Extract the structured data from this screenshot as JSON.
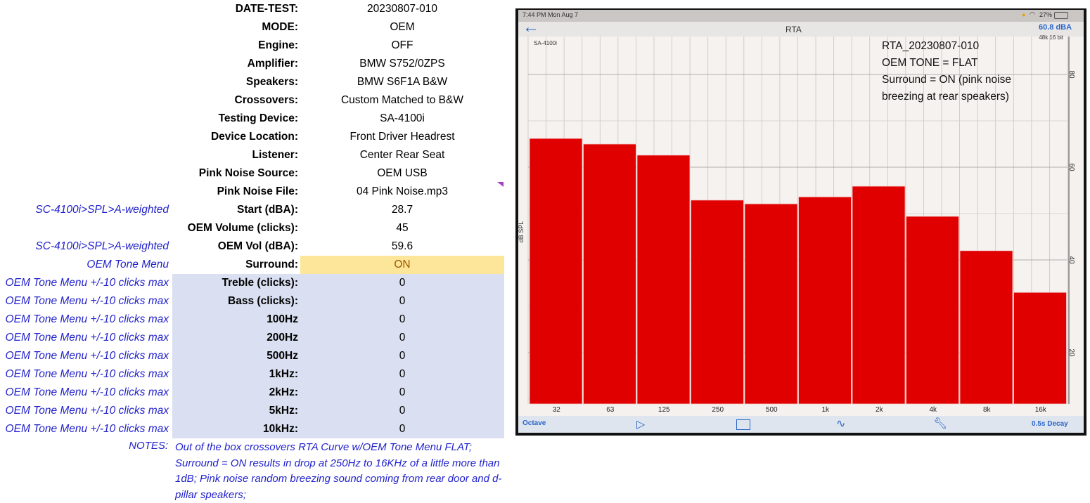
{
  "sheet": {
    "rows": [
      {
        "note": "",
        "label": "DATE-TEST:",
        "value": "20230807-010"
      },
      {
        "note": "",
        "label": "MODE:",
        "value": "OEM"
      },
      {
        "note": "",
        "label": "Engine:",
        "value": "OFF"
      },
      {
        "note": "",
        "label": "Amplifier:",
        "value": "BMW S752/0ZPS"
      },
      {
        "note": "",
        "label": "Speakers:",
        "value": "BMW S6F1A B&W"
      },
      {
        "note": "",
        "label": "Crossovers:",
        "value": "Custom Matched to B&W"
      },
      {
        "note": "",
        "label": "Testing Device:",
        "value": "SA-4100i"
      },
      {
        "note": "",
        "label": "Device Location:",
        "value": "Front Driver Headrest"
      },
      {
        "note": "",
        "label": "Listener:",
        "value": "Center Rear Seat"
      },
      {
        "note": "",
        "label": "Pink Noise Source:",
        "value": "OEM USB"
      },
      {
        "note": "",
        "label": "Pink Noise File:",
        "value": "04 Pink Noise.mp3"
      },
      {
        "note": "SC-4100i>SPL>A-weighted",
        "label": "Start (dBA):",
        "value": "28.7"
      },
      {
        "note": "",
        "label": "OEM Volume (clicks):",
        "value": "45"
      },
      {
        "note": "SC-4100i>SPL>A-weighted",
        "label": "OEM Vol (dBA):",
        "value": "59.6"
      },
      {
        "note": "OEM Tone Menu",
        "label": "Surround:",
        "value": "ON"
      },
      {
        "note": "OEM Tone Menu +/-10 clicks max",
        "label": "Treble (clicks):",
        "value": "0"
      },
      {
        "note": "OEM Tone Menu +/-10 clicks max",
        "label": "Bass (clicks):",
        "value": "0"
      },
      {
        "note": "OEM Tone Menu +/-10 clicks max",
        "label": "100Hz",
        "value": "0"
      },
      {
        "note": "OEM Tone Menu +/-10 clicks max",
        "label": "200Hz",
        "value": "0"
      },
      {
        "note": "OEM Tone Menu +/-10 clicks max",
        "label": "500Hz",
        "value": "0"
      },
      {
        "note": "OEM Tone Menu +/-10 clicks max",
        "label": "1kHz:",
        "value": "0"
      },
      {
        "note": "OEM Tone Menu +/-10 clicks max",
        "label": "2kHz:",
        "value": "0"
      },
      {
        "note": "OEM Tone Menu +/-10 clicks max",
        "label": "5kHz:",
        "value": "0"
      },
      {
        "note": "OEM Tone Menu +/-10 clicks max",
        "label": "10kHz:",
        "value": "0"
      }
    ],
    "notes_label": "NOTES:",
    "notes_text": "Out of the box crossovers RTA Curve w/OEM Tone Menu FLAT; Surround = ON results in drop at 250Hz to 16KHz of a little more than 1dB; Pink noise random breezing sound coming from rear door and d-pillar speakers;",
    "colors": {
      "surround_fill": "#fde699",
      "tone_fill": "#dae0f1",
      "note_text": "#2222cc"
    }
  },
  "app": {
    "status_time": "7:44 PM  Mon Aug 7",
    "battery": "27%",
    "title": "RTA",
    "level_readout": "60.8 dBA",
    "device": "SA-4100i",
    "sample_rate": "48k 16 bit",
    "overlay_lines": [
      "RTA_20230807-010",
      "OEM TONE = FLAT",
      "Surround = ON (pink noise",
      "breezing at rear speakers)"
    ],
    "toolbar": {
      "left": "Octave",
      "right": "0.5s Decay"
    },
    "icons": [
      "back-arrow-icon",
      "play-icon",
      "folder-icon",
      "waveform-icon",
      "wrench-icon",
      "wifi-icon",
      "battery-icon"
    ]
  },
  "chart_data": {
    "type": "bar",
    "ylabel": "dB SPL",
    "categories": [
      "32",
      "63",
      "125",
      "250",
      "500",
      "1k",
      "2k",
      "4k",
      "8k",
      "16k"
    ],
    "values": [
      66.2,
      65.0,
      62.6,
      52.9,
      52.1,
      53.6,
      55.9,
      49.4,
      42.0,
      33.0
    ],
    "yticks": [
      "80",
      "60",
      "40",
      "20"
    ],
    "ylim": [
      9,
      88
    ],
    "grid": true,
    "bar_color": "#e00000"
  }
}
